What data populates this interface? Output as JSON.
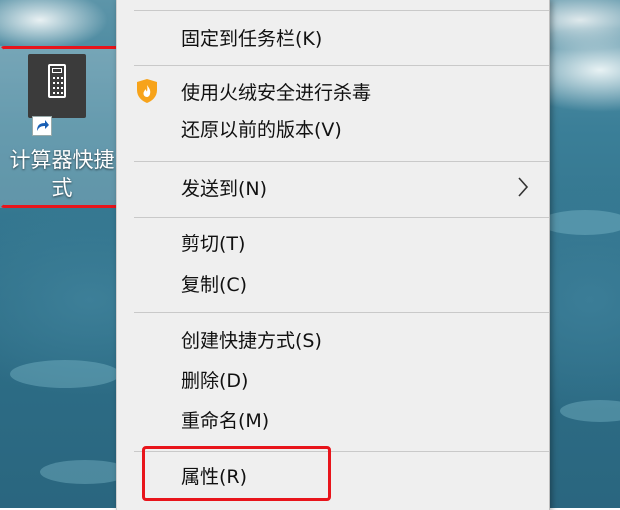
{
  "desktop": {
    "icon_label_line1": "计算器快捷",
    "icon_label_line2": "式",
    "highlight_color": "#e8141b"
  },
  "context_menu": {
    "items": [
      {
        "label": "固定到任务栏(K)"
      },
      {
        "label": "使用火绒安全进行杀毒",
        "icon": "huorong-shield-icon"
      },
      {
        "label": "还原以前的版本(V)"
      },
      {
        "label": "发送到(N)",
        "submenu": true
      },
      {
        "label": "剪切(T)"
      },
      {
        "label": "复制(C)"
      },
      {
        "label": "创建快捷方式(S)"
      },
      {
        "label": "删除(D)"
      },
      {
        "label": "重命名(M)"
      },
      {
        "label": "属性(R)"
      }
    ]
  }
}
